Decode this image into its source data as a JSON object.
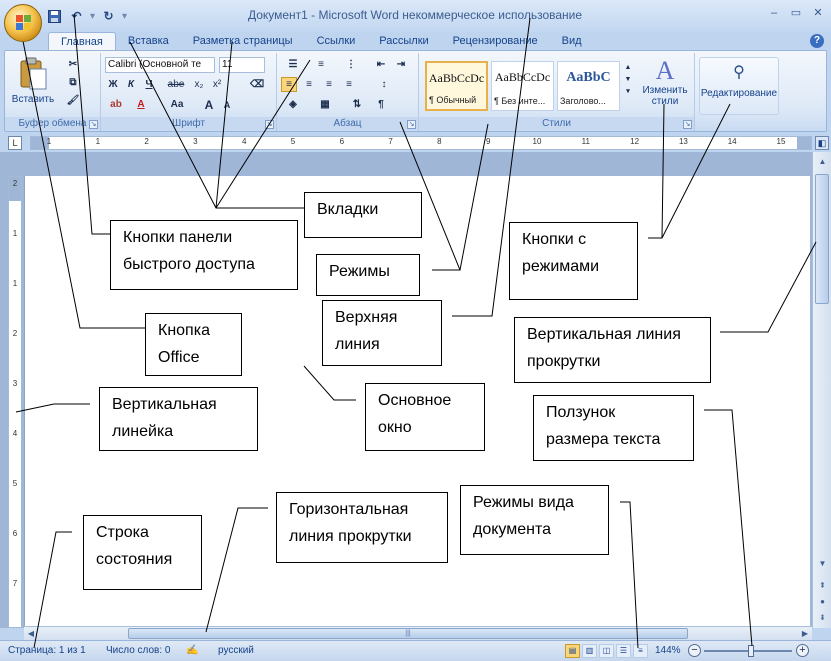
{
  "window": {
    "title": "Документ1 - Microsoft Word некоммерческое использование",
    "minimize": "–",
    "maximize": "▭",
    "close": "✕",
    "help": "?"
  },
  "qat": {
    "save_icon": "save-icon",
    "undo_icon": "undo-icon",
    "redo_icon": "redo-icon",
    "customize": "▾"
  },
  "tabs": [
    "Главная",
    "Вставка",
    "Разметка страницы",
    "Ссылки",
    "Рассылки",
    "Рецензирование",
    "Вид"
  ],
  "ribbon": {
    "clipboard": {
      "label": "Буфер обмена",
      "paste": "Вставить"
    },
    "font": {
      "label": "Шрифт",
      "font_name": "Calibri (Основной те",
      "font_size": "11",
      "bold": "Ж",
      "italic": "К",
      "underline": "Ч",
      "strike": "abe",
      "subscript": "x₂",
      "superscript": "x²",
      "grow": "A",
      "shrink": "A",
      "case": "Aa"
    },
    "paragraph": {
      "label": "Абзац"
    },
    "styles": {
      "label": "Стили",
      "items": [
        {
          "sample": "AaBbCcDc",
          "name": "¶ Обычный"
        },
        {
          "sample": "AaBbCcDc",
          "name": "¶ Без инте..."
        },
        {
          "sample": "AaBbC",
          "name": "Заголово..."
        }
      ],
      "change_styles": "Изменить стили"
    },
    "editing": {
      "label": "Редактирование"
    }
  },
  "hruler_numbers": [
    "1",
    "1",
    "2",
    "3",
    "4",
    "5",
    "6",
    "7",
    "8",
    "9",
    "10",
    "11",
    "12",
    "13",
    "14",
    "15"
  ],
  "vruler_numbers": [
    "2",
    "1",
    "1",
    "2",
    "3",
    "4",
    "5",
    "6",
    "7"
  ],
  "status": {
    "page": "Страница: 1 из 1",
    "words": "Число слов: 0",
    "language": "русский",
    "zoom": "144%",
    "zoom_fraction": 0.53
  },
  "callouts": {
    "tabs": "Вкладки",
    "qat": "Кнопки панели быстрого доступа",
    "modes": "Режимы",
    "mode_buttons": "Кнопки с режимами",
    "office": "Кнопка Office",
    "top_line": "Верхняя линия",
    "vscroll": "Вертикальная линия прокрутки",
    "vruler": "Вертикальная линейка",
    "main": "Основное окно",
    "zoom": "Ползунок размера текста",
    "status": "Строка состояния",
    "hscroll": "Горизонтальная линия прокрутки",
    "views": "Режимы вида документа"
  }
}
